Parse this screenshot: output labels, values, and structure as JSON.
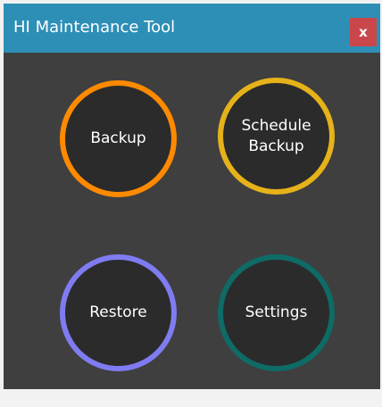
{
  "window": {
    "title": "HI Maintenance Tool",
    "close_label": "x"
  },
  "buttons": [
    {
      "label": "Backup",
      "color": "#ff8a00"
    },
    {
      "label": "Schedule\nBackup",
      "color": "#e6b21a"
    },
    {
      "label": "Restore",
      "color": "#7f7cf2"
    },
    {
      "label": "Settings",
      "color": "#0e6b66"
    }
  ],
  "colors": {
    "titlebar": "#2d8fb6",
    "window_bg": "#3f3f3f",
    "close_bg": "#c9474a",
    "circle_fill": "#2b2b2b"
  }
}
